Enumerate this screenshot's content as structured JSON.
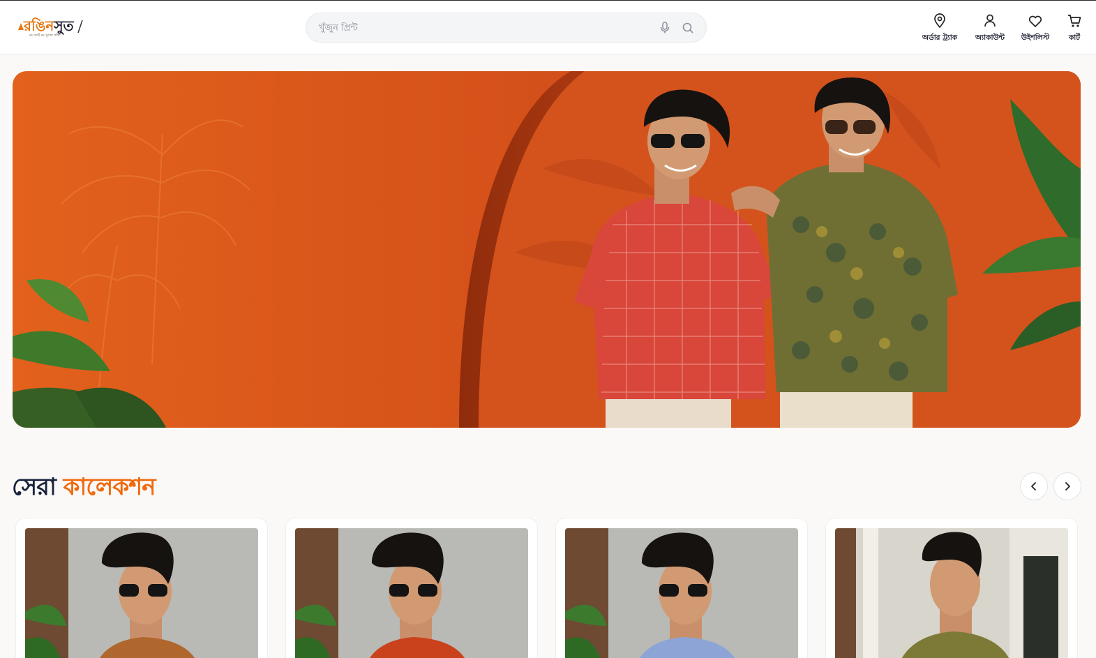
{
  "brand": {
    "name_part1": "রঙিন",
    "name_part2": "সুত",
    "tagline": "রং আর্ট রং সুতো গাঁথা",
    "accent_color": "#e57714"
  },
  "search": {
    "placeholder": "খুঁজুন প্রিন্ট",
    "mic_icon": "mic-icon",
    "search_icon": "search-icon"
  },
  "nav": {
    "order_track": "অর্ডার ট্র্যাক",
    "account": "অ্যাকাউন্ট",
    "wishlist": "উইশলিস্ট",
    "cart": "কার্ট"
  },
  "hero": {
    "background_color": "#d9531a"
  },
  "section": {
    "title_dark": "সেরা",
    "title_accent": "কালেকশন",
    "accent_color": "#f06a10"
  },
  "products": [
    {
      "shirt_color": "#b0672e"
    },
    {
      "shirt_color": "#c9421c"
    },
    {
      "shirt_color": "#8ca4d6"
    },
    {
      "shirt_color": "#7d7a38"
    }
  ]
}
